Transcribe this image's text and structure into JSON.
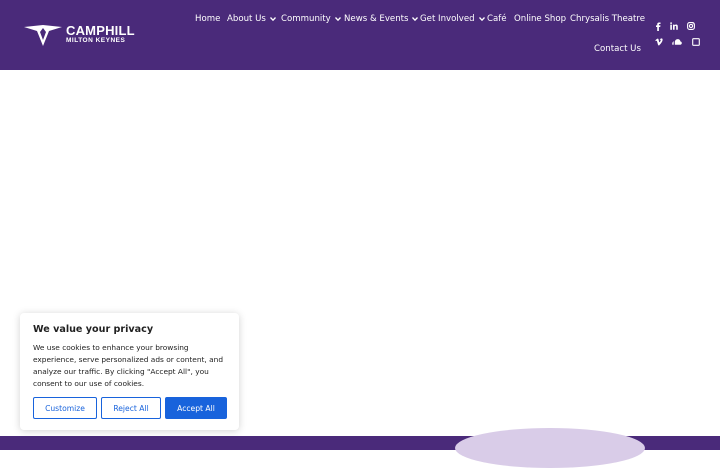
{
  "brand": {
    "name": "CAMPHILL",
    "subtitle": "MILTON KEYNES",
    "color": "#4a2a7a"
  },
  "nav": {
    "items": [
      {
        "label": "Home",
        "dropdown": false
      },
      {
        "label": "About Us",
        "dropdown": true
      },
      {
        "label": "Community",
        "dropdown": true
      },
      {
        "label": "News & Events",
        "dropdown": true
      },
      {
        "label": "Get Involved",
        "dropdown": true
      },
      {
        "label": "Café",
        "dropdown": false
      },
      {
        "label": "Online Shop",
        "dropdown": false
      },
      {
        "label": "Chrysalis Theatre",
        "dropdown": false
      },
      {
        "label": "Contact Us",
        "dropdown": false
      }
    ]
  },
  "social": {
    "icons": [
      "facebook-icon",
      "linkedin-icon",
      "instagram-icon",
      "vimeo-icon",
      "soundcloud-icon",
      "square-icon"
    ]
  },
  "cookie": {
    "title": "We value your privacy",
    "text": "We use cookies to enhance your browsing experience, serve personalized ads or content, and analyze our traffic. By clicking \"Accept All\", you consent to our use of cookies.",
    "customize_label": "Customize",
    "reject_label": "Reject All",
    "accept_label": "Accept All",
    "accent": "#1863dc"
  }
}
